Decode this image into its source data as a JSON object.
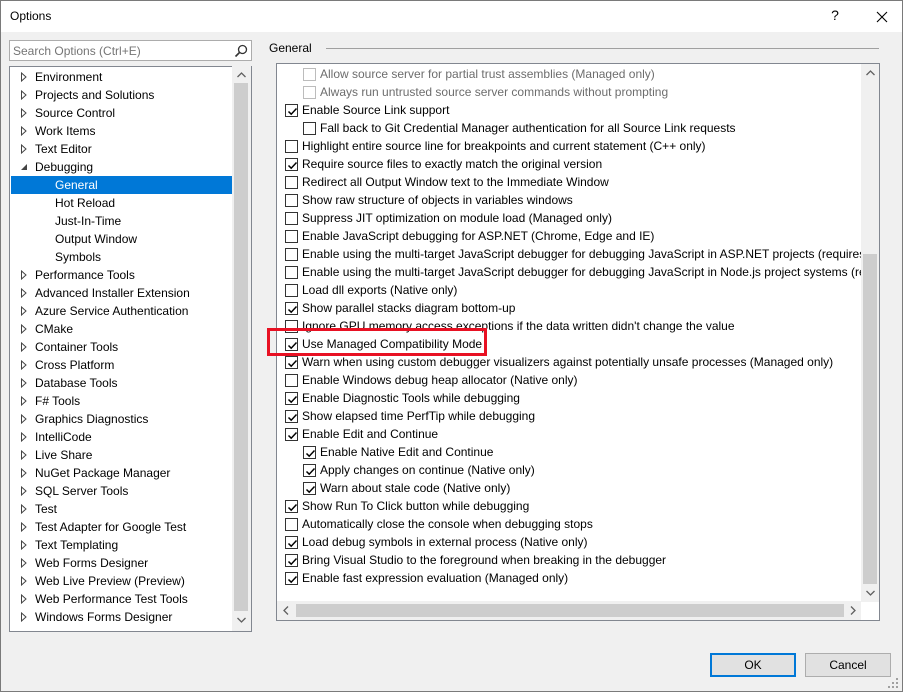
{
  "window": {
    "title": "Options",
    "help_glyph": "?"
  },
  "search": {
    "placeholder": "Search Options (Ctrl+E)"
  },
  "tree": {
    "items": [
      {
        "label": "Environment",
        "level": 0,
        "arrow": "collapsed"
      },
      {
        "label": "Projects and Solutions",
        "level": 0,
        "arrow": "collapsed"
      },
      {
        "label": "Source Control",
        "level": 0,
        "arrow": "collapsed"
      },
      {
        "label": "Work Items",
        "level": 0,
        "arrow": "collapsed"
      },
      {
        "label": "Text Editor",
        "level": 0,
        "arrow": "collapsed"
      },
      {
        "label": "Debugging",
        "level": 0,
        "arrow": "expanded"
      },
      {
        "label": "General",
        "level": 1,
        "arrow": "none",
        "selected": true
      },
      {
        "label": "Hot Reload",
        "level": 1,
        "arrow": "none"
      },
      {
        "label": "Just-In-Time",
        "level": 1,
        "arrow": "none"
      },
      {
        "label": "Output Window",
        "level": 1,
        "arrow": "none"
      },
      {
        "label": "Symbols",
        "level": 1,
        "arrow": "none"
      },
      {
        "label": "Performance Tools",
        "level": 0,
        "arrow": "collapsed"
      },
      {
        "label": "Advanced Installer Extension",
        "level": 0,
        "arrow": "collapsed"
      },
      {
        "label": "Azure Service Authentication",
        "level": 0,
        "arrow": "collapsed"
      },
      {
        "label": "CMake",
        "level": 0,
        "arrow": "collapsed"
      },
      {
        "label": "Container Tools",
        "level": 0,
        "arrow": "collapsed"
      },
      {
        "label": "Cross Platform",
        "level": 0,
        "arrow": "collapsed"
      },
      {
        "label": "Database Tools",
        "level": 0,
        "arrow": "collapsed"
      },
      {
        "label": "F# Tools",
        "level": 0,
        "arrow": "collapsed"
      },
      {
        "label": "Graphics Diagnostics",
        "level": 0,
        "arrow": "collapsed"
      },
      {
        "label": "IntelliCode",
        "level": 0,
        "arrow": "collapsed"
      },
      {
        "label": "Live Share",
        "level": 0,
        "arrow": "collapsed"
      },
      {
        "label": "NuGet Package Manager",
        "level": 0,
        "arrow": "collapsed"
      },
      {
        "label": "SQL Server Tools",
        "level": 0,
        "arrow": "collapsed"
      },
      {
        "label": "Test",
        "level": 0,
        "arrow": "collapsed"
      },
      {
        "label": "Test Adapter for Google Test",
        "level": 0,
        "arrow": "collapsed"
      },
      {
        "label": "Text Templating",
        "level": 0,
        "arrow": "collapsed"
      },
      {
        "label": "Web Forms Designer",
        "level": 0,
        "arrow": "collapsed"
      },
      {
        "label": "Web Live Preview (Preview)",
        "level": 0,
        "arrow": "collapsed"
      },
      {
        "label": "Web Performance Test Tools",
        "level": 0,
        "arrow": "collapsed"
      },
      {
        "label": "Windows Forms Designer",
        "level": 0,
        "arrow": "collapsed"
      }
    ]
  },
  "general": {
    "group_label": "General",
    "options": [
      {
        "label": "Allow source server for partial trust assemblies (Managed only)",
        "indent": 1,
        "checked": false,
        "disabled": true
      },
      {
        "label": "Always run untrusted source server commands without prompting",
        "indent": 1,
        "checked": false,
        "disabled": true
      },
      {
        "label": "Enable Source Link support",
        "indent": 0,
        "checked": true
      },
      {
        "label": "Fall back to Git Credential Manager authentication for all Source Link requests",
        "indent": 1,
        "checked": false
      },
      {
        "label": "Highlight entire source line for breakpoints and current statement (C++ only)",
        "indent": 0,
        "checked": false
      },
      {
        "label": "Require source files to exactly match the original version",
        "indent": 0,
        "checked": true
      },
      {
        "label": "Redirect all Output Window text to the Immediate Window",
        "indent": 0,
        "checked": false
      },
      {
        "label": "Show raw structure of objects in variables windows",
        "indent": 0,
        "checked": false
      },
      {
        "label": "Suppress JIT optimization on module load (Managed only)",
        "indent": 0,
        "checked": false
      },
      {
        "label": "Enable JavaScript debugging for ASP.NET (Chrome, Edge and IE)",
        "indent": 0,
        "checked": false
      },
      {
        "label": "Enable using the multi-target JavaScript debugger for debugging JavaScript in ASP.NET projects (requires d",
        "indent": 0,
        "checked": false
      },
      {
        "label": "Enable using the multi-target JavaScript debugger for debugging JavaScript in Node.js project systems (req",
        "indent": 0,
        "checked": false
      },
      {
        "label": "Load dll exports (Native only)",
        "indent": 0,
        "checked": false
      },
      {
        "label": "Show parallel stacks diagram bottom-up",
        "indent": 0,
        "checked": true
      },
      {
        "label": "Ignore GPU memory access exceptions if the data written didn't change the value",
        "indent": 0,
        "checked": false
      },
      {
        "label": "Use Managed Compatibility Mode",
        "indent": 0,
        "checked": true,
        "highlighted": true
      },
      {
        "label": "Warn when using custom debugger visualizers against potentially unsafe processes (Managed only)",
        "indent": 0,
        "checked": true
      },
      {
        "label": "Enable Windows debug heap allocator (Native only)",
        "indent": 0,
        "checked": false
      },
      {
        "label": "Enable Diagnostic Tools while debugging",
        "indent": 0,
        "checked": true
      },
      {
        "label": "Show elapsed time PerfTip while debugging",
        "indent": 0,
        "checked": true
      },
      {
        "label": "Enable Edit and Continue",
        "indent": 0,
        "checked": true
      },
      {
        "label": "Enable Native Edit and Continue",
        "indent": 1,
        "checked": true
      },
      {
        "label": "Apply changes on continue (Native only)",
        "indent": 1,
        "checked": true
      },
      {
        "label": "Warn about stale code (Native only)",
        "indent": 1,
        "checked": true
      },
      {
        "label": "Show Run To Click button while debugging",
        "indent": 0,
        "checked": true
      },
      {
        "label": "Automatically close the console when debugging stops",
        "indent": 0,
        "checked": false
      },
      {
        "label": "Load debug symbols in external process (Native only)",
        "indent": 0,
        "checked": true
      },
      {
        "label": "Bring Visual Studio to the foreground when breaking in the debugger",
        "indent": 0,
        "checked": true
      },
      {
        "label": "Enable fast expression evaluation (Managed only)",
        "indent": 0,
        "checked": true
      }
    ]
  },
  "buttons": {
    "ok": "OK",
    "cancel": "Cancel"
  },
  "colors": {
    "selection": "#0078d7",
    "highlight_box": "#e81123",
    "default_button_border": "#0078d7"
  }
}
